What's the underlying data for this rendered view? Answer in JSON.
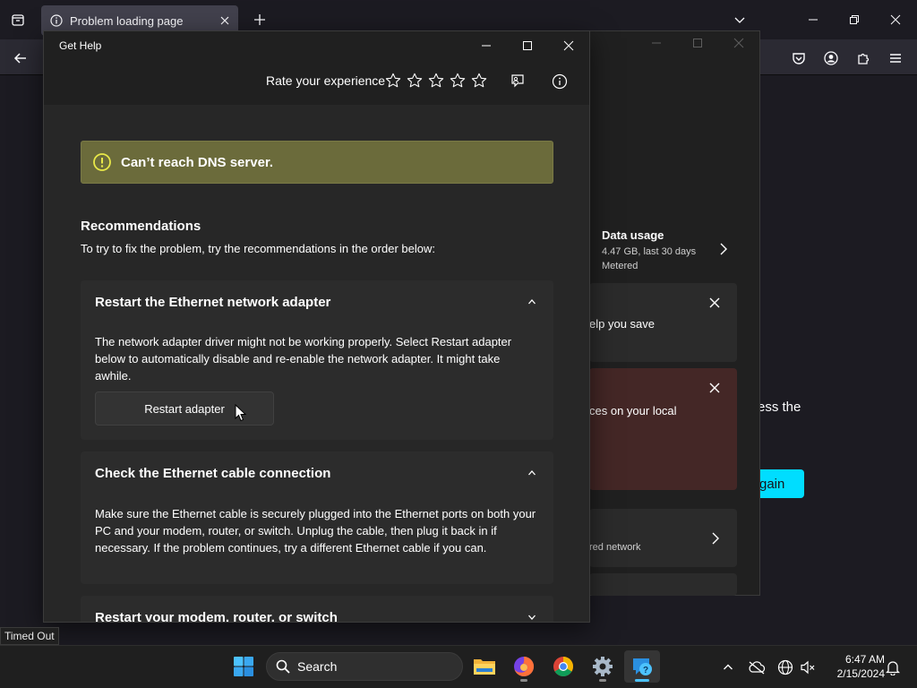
{
  "browser": {
    "tab_title": "Problem loading page",
    "status_text": "Timed Out",
    "page_fragment_access": "ess the",
    "page_fragment_try_again": "gain"
  },
  "settings": {
    "data_usage_title": "Data usage",
    "data_usage_amount": "4.47 GB, last 30 days",
    "data_usage_type": "Metered",
    "hint_fragment": "elp you save",
    "error_fragment": "ces on your local",
    "wired_fragment": "red network"
  },
  "gethelp": {
    "title": "Get Help",
    "rate_label": "Rate your experience",
    "banner_text": "Can’t reach DNS server.",
    "recommendations_heading": "Recommendations",
    "recommendations_intro": "To try to fix the problem, try the recommendations in the order below:",
    "cards": [
      {
        "title": "Restart the Ethernet network adapter",
        "body": "The network adapter driver might not be working properly. Select Restart adapter below to automatically disable and re-enable the network adapter. It might take awhile.",
        "button": "Restart adapter"
      },
      {
        "title": "Check the Ethernet cable connection",
        "body": "Make sure the Ethernet cable is securely plugged into the Ethernet ports on both your PC and your modem, router, or switch. Unplug the cable, then plug it back in if necessary. If the problem continues, try a different Ethernet cable if you can."
      },
      {
        "title": "Restart your modem, router, or switch"
      }
    ]
  },
  "taskbar": {
    "search_label": "Search",
    "time": "6:47 AM",
    "date": "2/15/2024"
  },
  "colors": {
    "banner_bg": "#6b6b3b",
    "warning_icon": "#e8e848",
    "accent": "#4cc2ff",
    "try_again_button": "#00ddff"
  }
}
